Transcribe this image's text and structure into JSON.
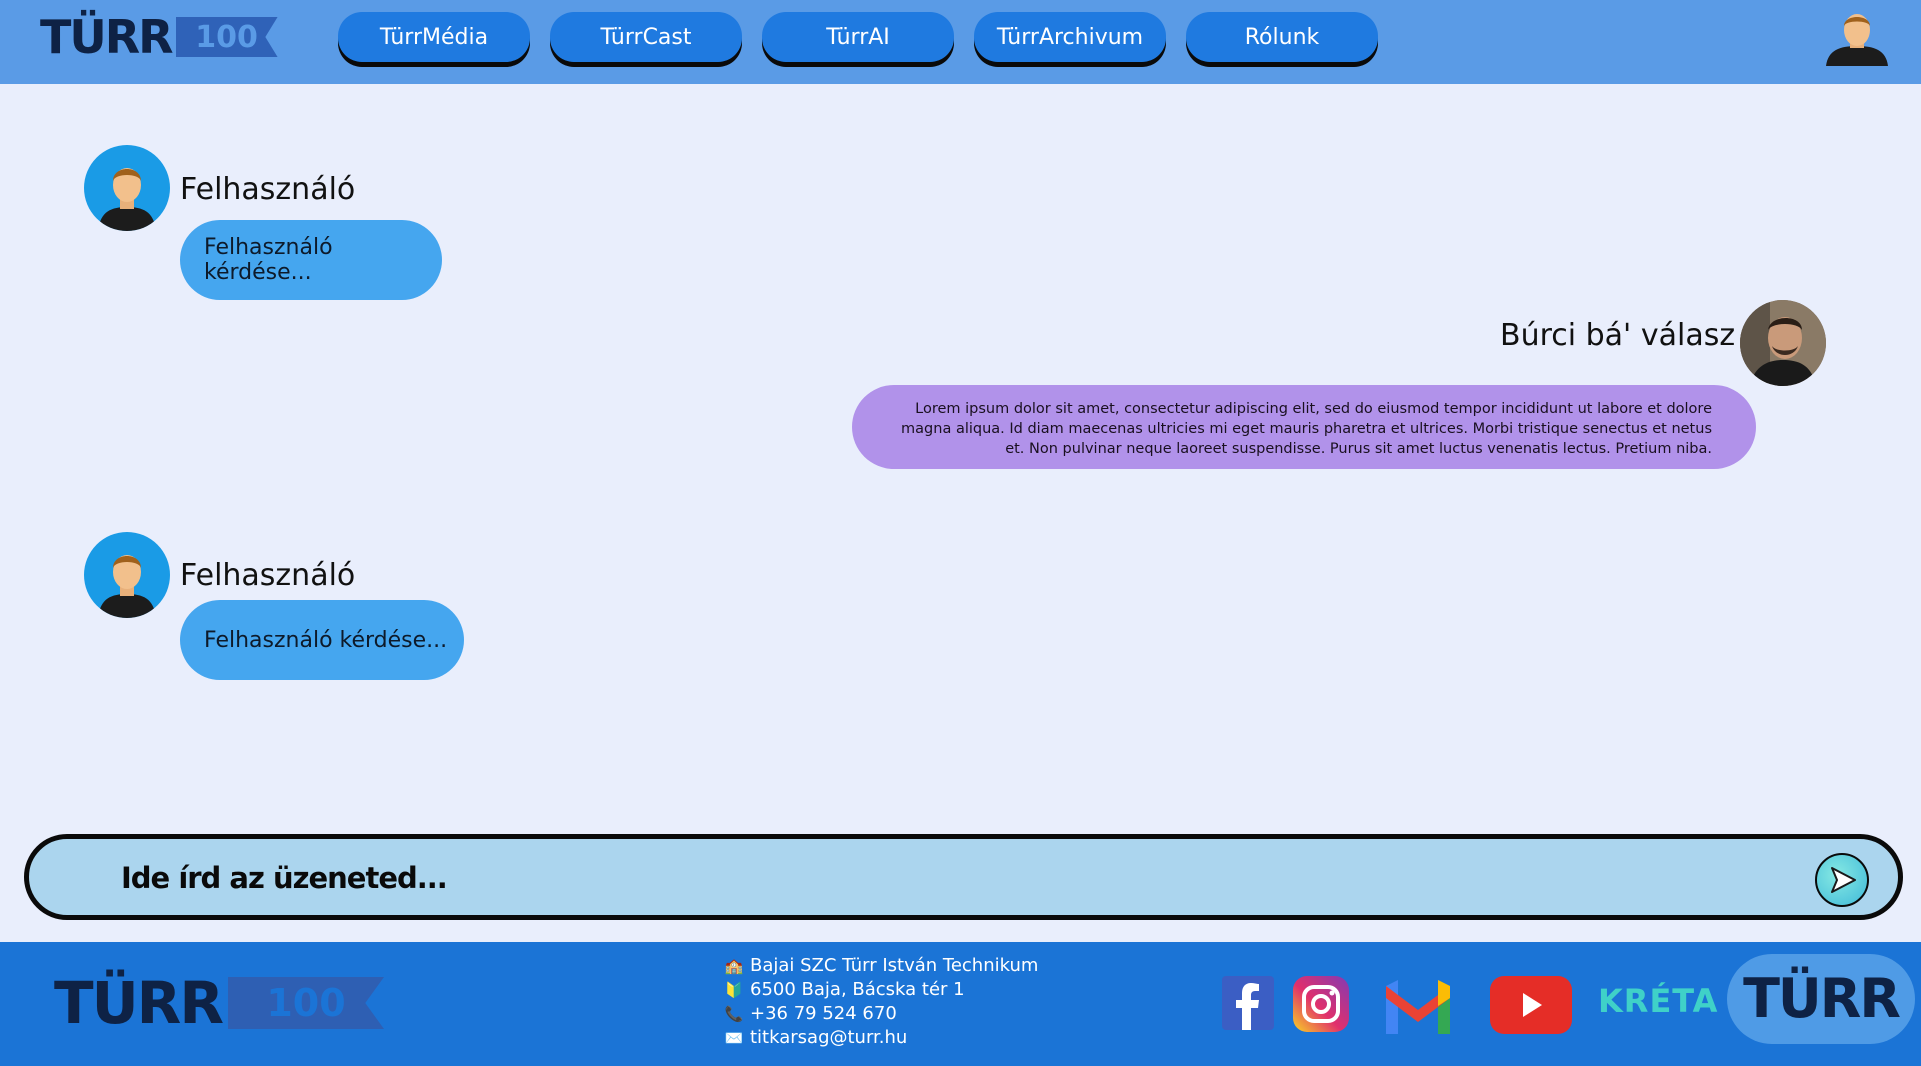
{
  "header": {
    "logo": {
      "word": "TÜRR",
      "badge": "100"
    },
    "nav": [
      "TürrMédia",
      "TürrCast",
      "TürrAI",
      "TürrArchivum",
      "Rólunk"
    ]
  },
  "chat": {
    "messages": [
      {
        "role": "user",
        "author": "Felhasználó",
        "text": "Felhasználó kérdése..."
      },
      {
        "role": "assistant",
        "author": "Búrci bá' válasz",
        "text": "Lorem ipsum dolor sit amet, consectetur adipiscing elit, sed do eiusmod tempor incididunt ut labore et dolore magna aliqua. Id diam maecenas ultricies mi eget mauris pharetra et ultrices. Morbi tristique senectus et netus et. Non pulvinar neque laoreet suspendisse. Purus sit amet luctus venenatis lectus. Pretium niba."
      },
      {
        "role": "user",
        "author": "Felhasználó",
        "text": "Felhasználó kérdése..."
      }
    ]
  },
  "composer": {
    "placeholder": "Ide írd az üzeneted..."
  },
  "footer": {
    "logo": {
      "word": "TÜRR",
      "badge": "100"
    },
    "contact": {
      "school": "Bajai SZC Türr István Technikum",
      "address": "6500 Baja, Bácska tér 1",
      "phone": "+36 79 524 670",
      "email": "titkarsag@turr.hu"
    },
    "social": [
      "facebook-icon",
      "instagram-icon",
      "gmail-icon",
      "youtube-icon",
      "kreta-icon"
    ],
    "kreta_label": "KRÉTA",
    "badge_word": "TÜRR"
  },
  "colors": {
    "header_bg": "#5a9be6",
    "nav_button": "#1f7ae0",
    "page_bg": "#e9eefc",
    "user_bubble": "#45a6ef",
    "bot_bubble": "#b192ea",
    "composer_bg": "#abd5ee",
    "footer_bg": "#1b74d6"
  }
}
